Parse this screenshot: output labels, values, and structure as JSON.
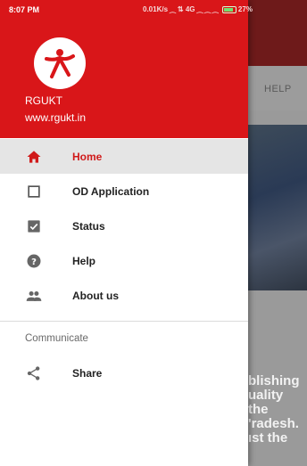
{
  "status_bar": {
    "time": "8:07 PM",
    "right_text": "0.01K/s ⁔ ⇅ 4G ⁔ ⁔ ⁔",
    "battery": "27%"
  },
  "drawer": {
    "header": {
      "title": "RGUKT",
      "url": "www.rgukt.in",
      "logo_icon": "rgukt-logo"
    },
    "items": [
      {
        "label": "Home",
        "icon": "home-icon",
        "selected": true
      },
      {
        "label": "OD Application",
        "icon": "checkbox-empty-icon",
        "selected": false
      },
      {
        "label": "Status",
        "icon": "checkbox-checked-icon",
        "selected": false
      },
      {
        "label": "Help",
        "icon": "help-icon",
        "selected": false
      },
      {
        "label": "About us",
        "icon": "people-icon",
        "selected": false
      }
    ],
    "section_title": "Communicate",
    "share": {
      "label": "Share",
      "icon": "share-icon"
    }
  },
  "background": {
    "tab_label": "HELP",
    "text_fragment": "blishing\nuality\nthe\n'radesh.\nıst the"
  },
  "colors": {
    "primary": "#d91619",
    "selected_text": "#d01a1a",
    "selected_bg": "#e5e5e5"
  }
}
